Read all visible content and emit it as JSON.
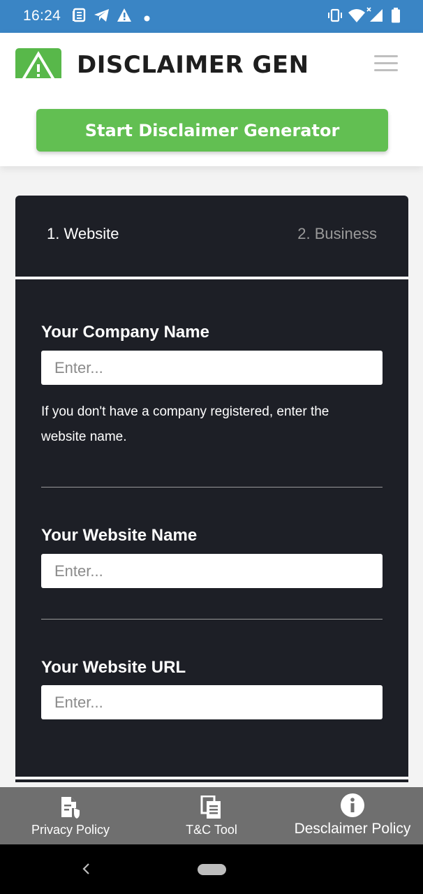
{
  "status_bar": {
    "time": "16:24",
    "icons": [
      "news-icon",
      "telegram-icon",
      "warning-icon",
      "dot-icon",
      "vibrate-icon",
      "wifi-icon",
      "signal-icon",
      "battery-icon"
    ]
  },
  "header": {
    "logo_text": "DISCLAIMER GEN",
    "menu_icon": "hamburger-menu-icon",
    "cta_label": "Start Disclaimer Generator"
  },
  "form": {
    "steps": [
      {
        "label": "1. Website",
        "active": true
      },
      {
        "label": "2. Business",
        "active": false
      }
    ],
    "fields": [
      {
        "label": "Your Company Name",
        "placeholder": "Enter...",
        "value": ""
      },
      {
        "label": "Your Website Name",
        "placeholder": "Enter...",
        "value": ""
      },
      {
        "label": "Your Website URL",
        "placeholder": "Enter...",
        "value": ""
      }
    ],
    "company_help": "If you don't have a company registered, enter the website name."
  },
  "tabbar": {
    "items": [
      {
        "label": "Privacy Policy",
        "icon": "privacy-document-icon"
      },
      {
        "label": "T&C Tool",
        "icon": "documents-icon"
      },
      {
        "label": "Desclaimer Policy",
        "icon": "info-icon"
      }
    ]
  },
  "colors": {
    "status_bar": "#3a85c5",
    "brand_green": "#62bf52",
    "card_dark": "#1d1f26",
    "tabbar_gray": "#6f6f6f"
  }
}
